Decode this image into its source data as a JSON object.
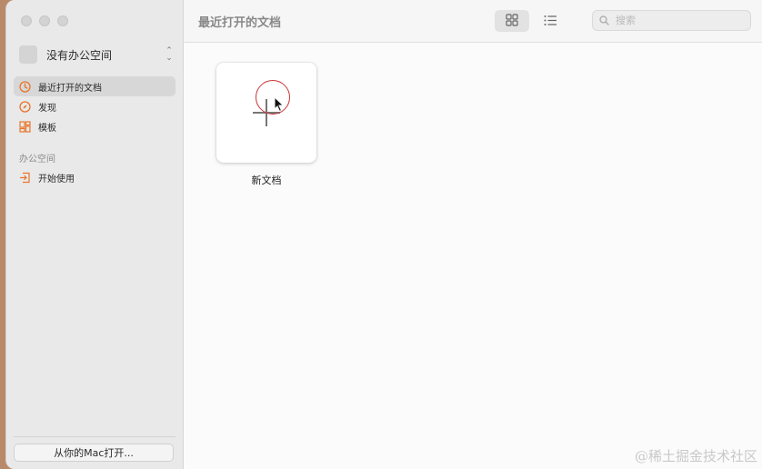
{
  "window": {
    "traffic_lights": [
      "close",
      "minimize",
      "zoom"
    ]
  },
  "workspace": {
    "name": "没有办公空间",
    "chevron_icon": "chevron-up-down-icon"
  },
  "sidebar": {
    "items": [
      {
        "label": "最近打开的文档",
        "icon": "clock-icon",
        "active": true
      },
      {
        "label": "发现",
        "icon": "compass-icon",
        "active": false
      },
      {
        "label": "模板",
        "icon": "template-grid-icon",
        "active": false
      }
    ],
    "section_title": "办公空间",
    "section_items": [
      {
        "label": "开始使用",
        "icon": "enter-icon"
      }
    ],
    "open_from_mac_label": "从你的Mac打开..."
  },
  "toolbar": {
    "title": "最近打开的文档",
    "view_modes": [
      {
        "icon": "grid-view-icon",
        "active": true
      },
      {
        "icon": "list-view-icon",
        "active": false
      }
    ],
    "search_placeholder": "搜索"
  },
  "content": {
    "new_document_label": "新文档"
  },
  "watermark": "@稀土掘金技术社区",
  "colors": {
    "accent_orange": "#e8762c",
    "click_ring": "#c8363a",
    "sidebar_bg": "#e9e9e9"
  }
}
